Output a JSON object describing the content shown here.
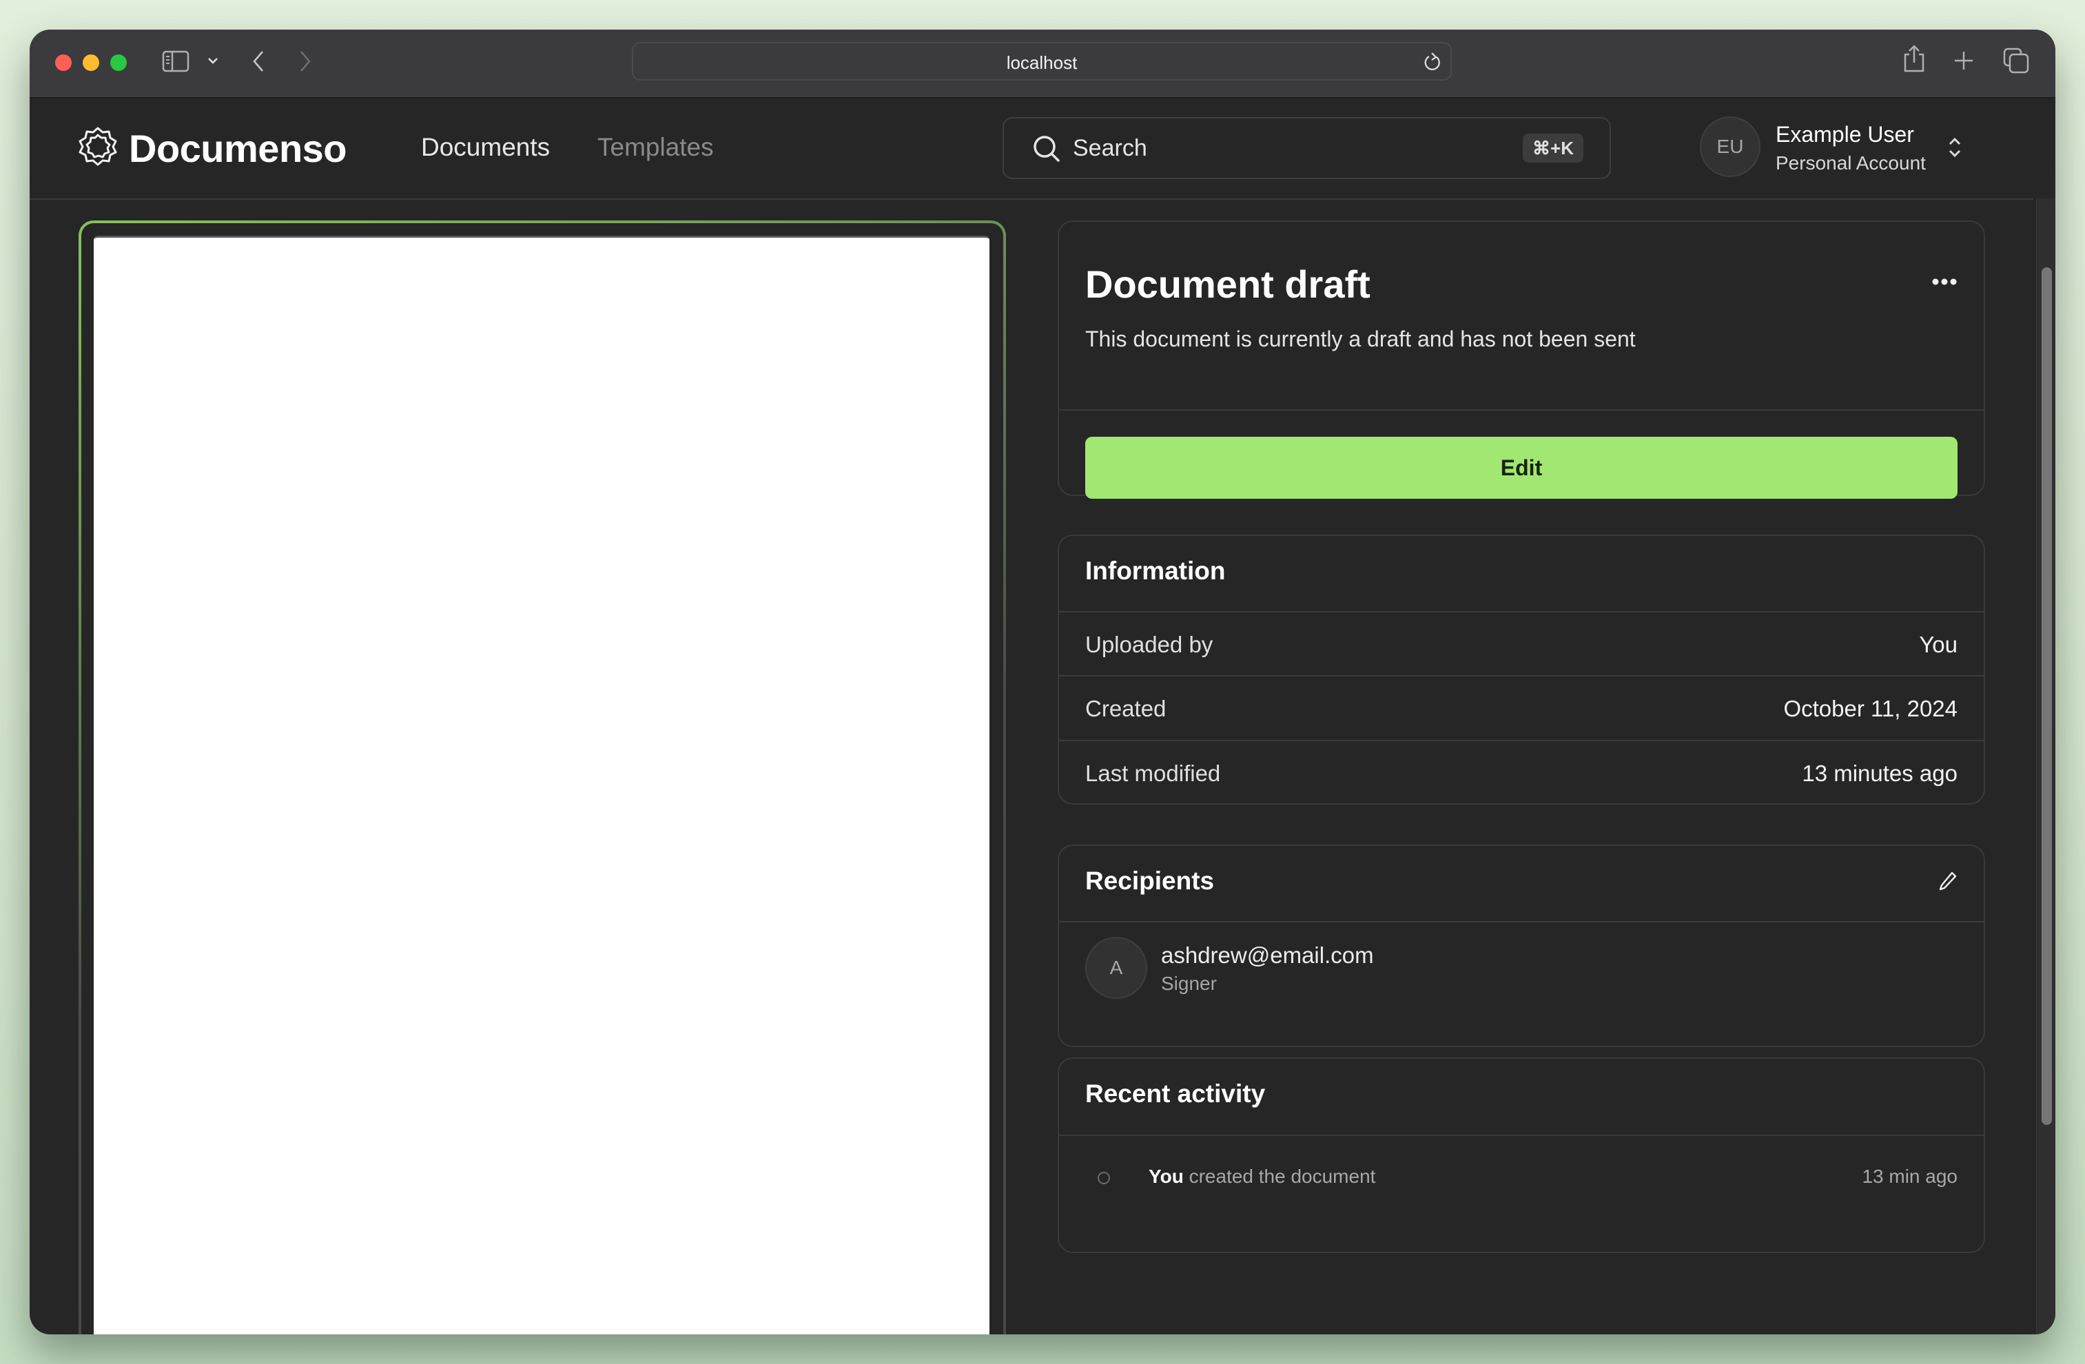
{
  "browser": {
    "url": "localhost",
    "traffic_lights": [
      "close",
      "minimize",
      "zoom"
    ],
    "icons": [
      "sidebar-icon",
      "chevron-down-icon",
      "back-icon",
      "forward-icon",
      "reload-icon",
      "share-icon",
      "new-tab-icon",
      "tab-overview-icon"
    ]
  },
  "header": {
    "brand": "Documenso",
    "nav": [
      {
        "label": "Documents",
        "active": true
      },
      {
        "label": "Templates",
        "active": false
      }
    ],
    "search": {
      "placeholder": "Search",
      "shortcut": "⌘+K"
    },
    "user": {
      "initials": "EU",
      "name": "Example User",
      "account": "Personal Account"
    }
  },
  "status_card": {
    "title": "Document draft",
    "description": "This document is currently a draft and has not been sent",
    "primary_action": "Edit",
    "accent_color": "#a2e771"
  },
  "information": {
    "title": "Information",
    "rows": [
      {
        "label": "Uploaded by",
        "value": "You"
      },
      {
        "label": "Created",
        "value": "October 11, 2024"
      },
      {
        "label": "Last modified",
        "value": "13 minutes ago"
      }
    ]
  },
  "recipients": {
    "title": "Recipients",
    "items": [
      {
        "initial": "A",
        "email": "ashdrew@email.com",
        "role": "Signer"
      }
    ]
  },
  "activity": {
    "title": "Recent activity",
    "items": [
      {
        "actor": "You",
        "action": "created the document",
        "time": "13 min ago"
      }
    ]
  }
}
